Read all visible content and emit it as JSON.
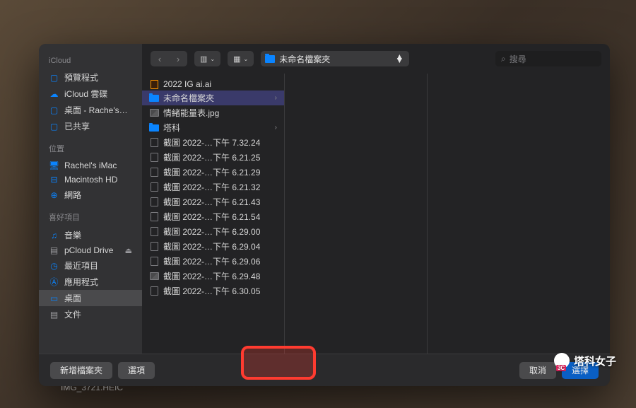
{
  "behind_label": "IMG_3721.HEIC",
  "sidebar": {
    "sections": [
      {
        "header": "iCloud",
        "items": [
          {
            "label": "預覽程式",
            "icon": "folder"
          },
          {
            "label": "iCloud 雲碟",
            "icon": "cloud"
          },
          {
            "label": "桌面 - Rache's…",
            "icon": "folder"
          },
          {
            "label": "已共享",
            "icon": "folder"
          }
        ]
      },
      {
        "header": "位置",
        "items": [
          {
            "label": "Rachel's iMac",
            "icon": "display"
          },
          {
            "label": "Macintosh HD",
            "icon": "disk"
          },
          {
            "label": "網路",
            "icon": "globe"
          }
        ]
      },
      {
        "header": "喜好項目",
        "items": [
          {
            "label": "音樂",
            "icon": "music"
          },
          {
            "label": "pCloud Drive",
            "icon": "doc",
            "eject": true
          },
          {
            "label": "最近項目",
            "icon": "clock"
          },
          {
            "label": "應用程式",
            "icon": "apps"
          },
          {
            "label": "桌面",
            "icon": "desktop",
            "active": true
          },
          {
            "label": "文件",
            "icon": "doc"
          }
        ]
      }
    ]
  },
  "toolbar": {
    "path_label": "未命名檔案夾",
    "search_placeholder": "搜尋"
  },
  "column1": [
    {
      "label": "2022 IG ai.ai",
      "type": "ai"
    },
    {
      "label": "未命名檔案夾",
      "type": "folder",
      "selected": true,
      "arrow": true
    },
    {
      "label": "情緒能量表.jpg",
      "type": "img"
    },
    {
      "label": "塔科",
      "type": "folder",
      "arrow": true
    },
    {
      "label": "截圖 2022-…下午 7.32.24",
      "type": "doc"
    },
    {
      "label": "截圖 2022-…下午 6.21.25",
      "type": "doc"
    },
    {
      "label": "截圖 2022-…下午 6.21.29",
      "type": "doc"
    },
    {
      "label": "截圖 2022-…下午 6.21.32",
      "type": "doc"
    },
    {
      "label": "截圖 2022-…下午 6.21.43",
      "type": "doc"
    },
    {
      "label": "截圖 2022-…下午 6.21.54",
      "type": "doc"
    },
    {
      "label": "截圖 2022-…下午 6.29.00",
      "type": "doc"
    },
    {
      "label": "截圖 2022-…下午 6.29.04",
      "type": "doc"
    },
    {
      "label": "截圖 2022-…下午 6.29.06",
      "type": "doc"
    },
    {
      "label": "截圖 2022-…下午 6.29.48",
      "type": "img"
    },
    {
      "label": "截圖 2022-…下午 6.30.05",
      "type": "doc"
    }
  ],
  "footer": {
    "new_folder": "新增檔案夾",
    "options": "選項",
    "cancel": "取消",
    "choose": "選擇"
  },
  "watermark": "塔科女子"
}
